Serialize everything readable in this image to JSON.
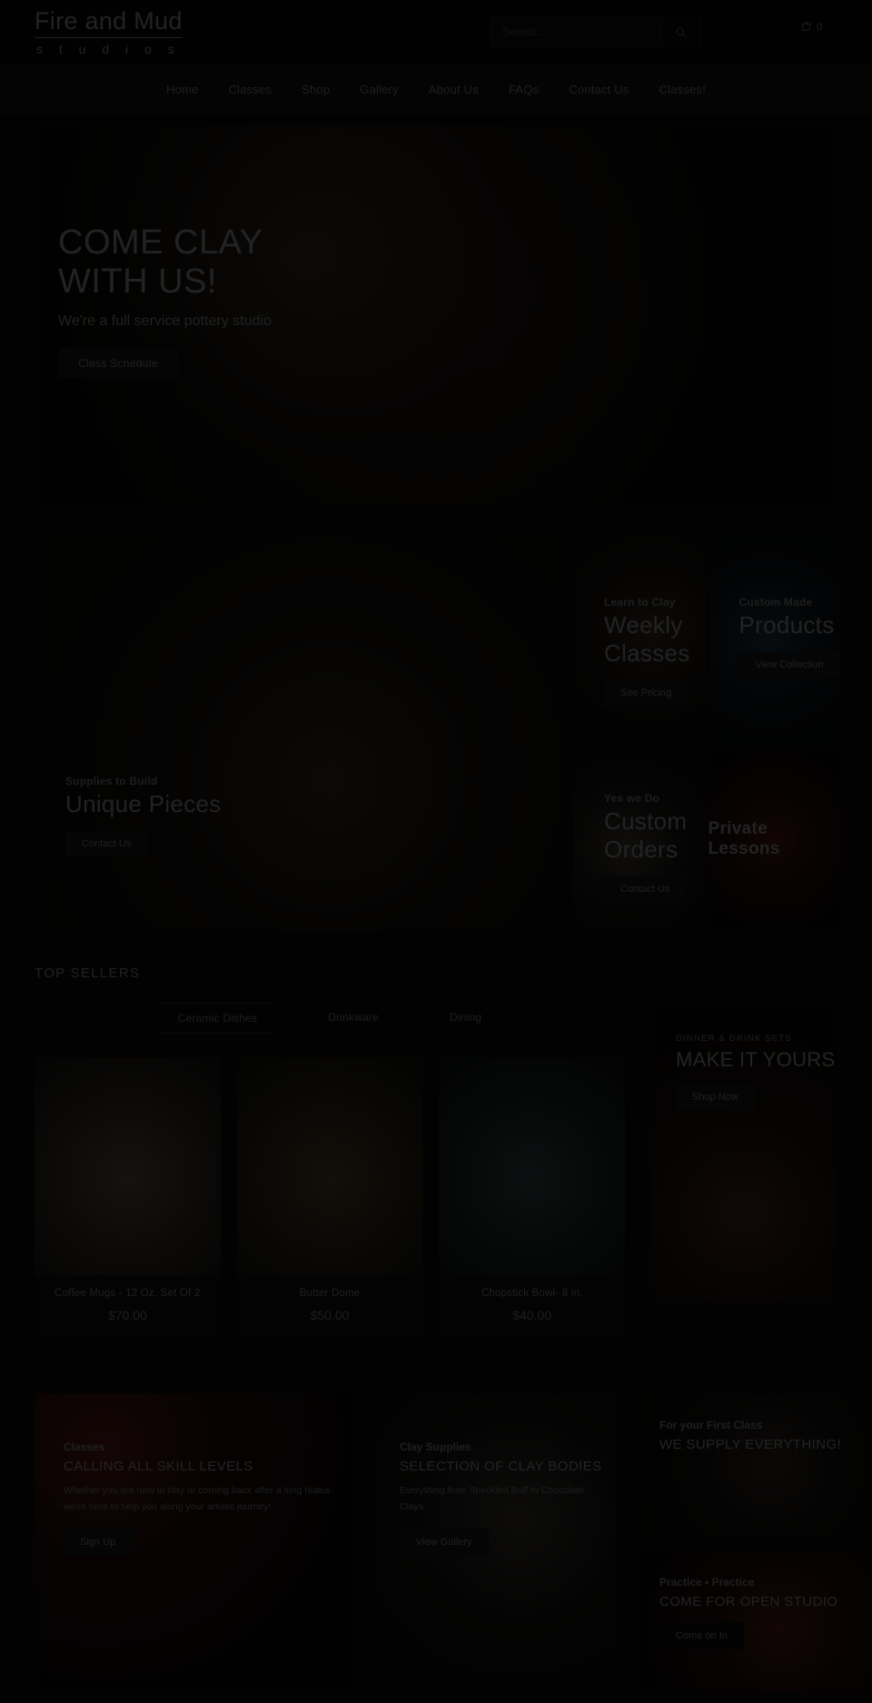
{
  "header": {
    "logo_main": "Fire and Mud",
    "logo_sub": "s t u d i o s",
    "search_placeholder": "Search...",
    "search_value": "",
    "search_icon": "search-icon",
    "cart_icon": "cart-icon",
    "cart_count": "0"
  },
  "nav": {
    "items": [
      {
        "label": "Home"
      },
      {
        "label": "Classes"
      },
      {
        "label": "Shop"
      },
      {
        "label": "Gallery"
      },
      {
        "label": "About Us"
      },
      {
        "label": "FAQs"
      },
      {
        "label": "Contact Us"
      },
      {
        "label": "Classes!"
      }
    ]
  },
  "hero": {
    "title_line1": "COME CLAY",
    "title_line2": "WITH US!",
    "subtitle": "We're a full service pottery studio",
    "cta": "Class Schedule"
  },
  "feature_grid": {
    "cells": [
      {
        "eyebrow": "Learn to Clay",
        "title": "Weekly Classes",
        "cta": "See Pricing"
      },
      {
        "eyebrow": "Custom Made",
        "title": "Products",
        "cta": "View Collection"
      },
      {
        "eyebrow": "Supplies to Build",
        "title": "Unique Pieces",
        "cta": "Contact Us"
      },
      {
        "eyebrow": "Yes we Do",
        "title": "Custom Orders",
        "cta": "Contact Us"
      },
      {
        "title": "Private Lessons"
      }
    ]
  },
  "top_sellers": {
    "heading": "TOP SELLERS",
    "tabs": [
      {
        "label": "Ceramic Dishes",
        "active": true
      },
      {
        "label": "Drinkware",
        "active": false
      },
      {
        "label": "Dining",
        "active": false
      }
    ],
    "products": [
      {
        "name": "Coffee Mugs - 12 Oz. Set Of 2",
        "price": "$70.00"
      },
      {
        "name": "Butter Dome",
        "price": "$50.00"
      },
      {
        "name": "Chopstick Bowl- 8 in.",
        "price": "$40.00"
      }
    ],
    "promo": {
      "eyebrow": "DINNER & DRINK SETS",
      "title": "MAKE IT YOURS",
      "cta": "Shop Now"
    }
  },
  "bottom_cards": [
    {
      "eyebrow": "Classes",
      "title": "CALLING ALL SKILL LEVELS",
      "body": "Whether you are new to clay or coming back after a long hiatus we're here to help you along your artistic journey!",
      "cta": "Sign Up"
    },
    {
      "eyebrow": "Clay Supplies",
      "title": "SELECTION OF CLAY BODIES",
      "body": "Everything from Speckled Buff to Chocolate Clays.",
      "cta": "View Gallery"
    },
    {
      "eyebrow": "For your First Class",
      "title": "WE SUPPLY EVERYTHING!",
      "body": "",
      "cta": ""
    },
    {
      "eyebrow": "Practice • Practice",
      "title": "COME FOR OPEN STUDIO",
      "body": "",
      "cta": "Come on In"
    }
  ]
}
